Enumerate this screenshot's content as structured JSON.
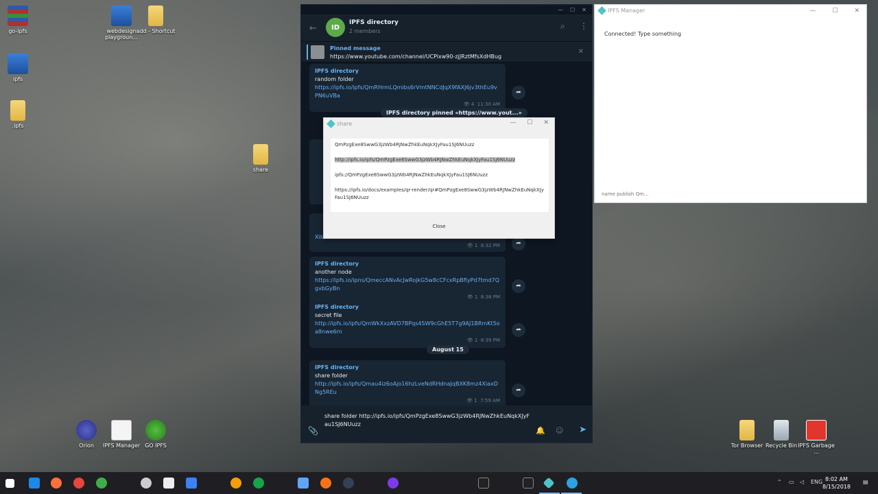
{
  "desktop": {
    "icons_left": [
      {
        "label": "go-ipfs",
        "icon": "winrar-archive-icon"
      },
      {
        "label": "ipfs",
        "icon": "window-app-icon"
      },
      {
        "label": ".ipfs",
        "icon": "folder-icon"
      },
      {
        "label": "webdesign playgroun...",
        "icon": "shortcut-folder-icon"
      },
      {
        "label": "add - Shortcut",
        "icon": "folder-shortcut-icon"
      },
      {
        "label": "share",
        "icon": "folder-icon"
      }
    ],
    "icons_bottom": [
      {
        "label": "Orion",
        "icon": "orion-icon"
      },
      {
        "label": "IPFS Manager",
        "icon": "java-icon"
      },
      {
        "label": "GO IPFS",
        "icon": "tree-icon"
      }
    ],
    "icons_right": [
      {
        "label": "Tor Browser",
        "icon": "tor-icon"
      },
      {
        "label": "Recycle Bin",
        "icon": "recycle-bin-icon"
      },
      {
        "label": "IPFS Garbage ...",
        "icon": "power-icon"
      }
    ]
  },
  "telegram": {
    "window_controls": [
      "—",
      "☐",
      "✕"
    ],
    "chat_title": "IPFS directory",
    "chat_subtitle": "2 members",
    "avatar_initials": "ID",
    "avatar_color": "#5caa49",
    "pinned_label": "Pinned message",
    "pinned_text": "https://www.youtube.com/channel/UCPixw90-zjJRztMfsXdHBug",
    "messages": [
      {
        "sender": "IPFS directory",
        "text": "random folder",
        "link": "https://ipfs.io/ipfs/QmRHrmLQmibs6rVmtNNCdJqX9fAXJ6jv3thEu9vPN6uVBa",
        "views": "4",
        "time": "11:30 AM"
      },
      {
        "sender": "IPFS directory",
        "text": "another node",
        "link": "https://ipfs.io/ipns/QmeccANvAcJwRojkG5w8cCFcxRpBfiyPd7tmd7QgvbGyBn",
        "views": "1",
        "time": "8:38 PM"
      },
      {
        "sender": "IPFS directory",
        "text": "secret file",
        "link": "http://ipfs.io/ipfs/QmWkXxzAVD7BPqs4SW9cGhE5T7g9AJ1BRmKt5oa8nwe6rn",
        "views": "1",
        "time": "8:39 PM"
      },
      {
        "sender": "IPFS directory",
        "text": "share folder",
        "link": "http://ipfs.io/ipfs/Qmau4iz6oAjo16hzLveNdRHdnaJqBXK8mz4XiaxDNg5REu",
        "views": "1",
        "time": "7:59 AM"
      }
    ],
    "partial_message": {
      "link_tail": "Xikzs3Y",
      "views": "1",
      "time": "8:32 PM"
    },
    "service_pinned": "IPFS directory pinned «https://www.yout...»",
    "date_separator": "August 15",
    "composer_text": "share folder http://ipfs.io/ipfs/QmPzgExe8SwwG3jzWb4RJNwZhkEuNqkXJyFau1SJ6NUuzz"
  },
  "share_dialog": {
    "title": "share",
    "lines": [
      "QmPzgExe8SwwG3jzWb4RJNwZhkEuNqkXJyFau1SJ6NUuzz",
      "http://ipfs.io/ipfs/QmPzgExe8SwwG3jzWb4RJNwZhkEuNqkXJyFau1SJ6NUuzz",
      "ipfs://QmPzgExe8SwwG3jzWb4RJNwZhkEuNqkXJyFau1SJ6NUuzz",
      "https://ipfs.io/docs/examples/qr-render/qr#QmPzgExe8SwwG3jzWb4RJNwZhkEuNqkXJyFau1SJ6NUuzz"
    ],
    "close_label": "Close"
  },
  "ipfs_manager": {
    "title": "IPFS Manager",
    "status": "Connected! Type something",
    "input_placeholder": "name publish Qm..."
  },
  "taskbar": {
    "language": "ENG",
    "time": "8:02 AM",
    "date": "8/15/2018"
  }
}
